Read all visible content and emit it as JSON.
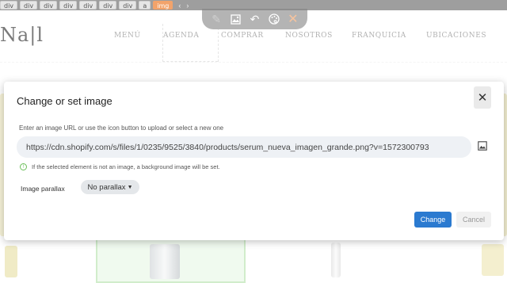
{
  "breadcrumb": {
    "items": [
      "div",
      "div",
      "div",
      "div",
      "div",
      "div",
      "div",
      "a",
      "img"
    ],
    "prev": "‹",
    "next": "›"
  },
  "toolbar": {
    "icons": [
      "pencil-icon",
      "image-icon",
      "undo-icon",
      "palette-icon",
      "close-icon"
    ]
  },
  "site": {
    "logo": "Na|l",
    "nav": [
      "MENÚ",
      "AGENDA",
      "COMPRAR",
      "NOSOTROS",
      "FRANQUICIA",
      "UBICACIONES"
    ]
  },
  "modal": {
    "title": "Change or set image",
    "hint": "Enter an image URL or use the icon button to upload or select a new one",
    "url_value": "https://cdn.shopify.com/s/files/1/0235/9525/3840/products/serum_nueva_imagen_grande.png?v=1572300793",
    "info": "If the selected element is not an image, a background image will be set.",
    "parallax_label": "Image parallax",
    "parallax_value": "No parallax",
    "change_label": "Change",
    "cancel_label": "Cancel"
  },
  "colors": {
    "accent": "#2b7ad0",
    "toolbar": "#8d8d8d",
    "crumb_active": "#f2a36b"
  }
}
